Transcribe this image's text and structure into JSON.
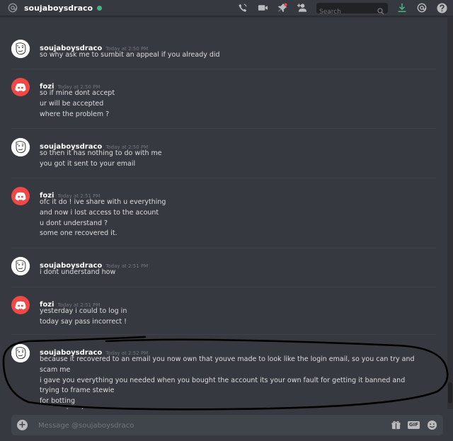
{
  "header": {
    "channel_name": "soujaboysdraco",
    "search_placeholder": "Search"
  },
  "icons": {
    "header": [
      "at-icon",
      "call-icon",
      "video-icon",
      "pin-icon",
      "add-friend-icon",
      "search-icon",
      "download-icon",
      "mention-icon",
      "help-icon"
    ],
    "composer": [
      "add-attachment-icon",
      "gift-icon",
      "gif-icon",
      "emoji-icon"
    ]
  },
  "colors": {
    "background": "#36393f",
    "online_status": "#43b581",
    "fozi_avatar": "#f04747",
    "download_icon": "#43b581"
  },
  "messages": [
    {
      "author": "soujaboysdraco",
      "timestamp": "Today at 2:50 PM",
      "avatar": "draco",
      "lines": [
        "so why ask me to sumbit an appeal if you already did"
      ]
    },
    {
      "author": "fozi",
      "timestamp": "Today at 2:50 PM",
      "avatar": "fozi",
      "lines": [
        "so if mine dont accept",
        "ur will be accepted",
        "where the problem ?"
      ]
    },
    {
      "author": "soujaboysdraco",
      "timestamp": "Today at 2:50 PM",
      "avatar": "draco",
      "lines": [
        "so then it has nothing to do with me",
        "you got it sent to your email"
      ]
    },
    {
      "author": "fozi",
      "timestamp": "Today at 2:51 PM",
      "avatar": "fozi",
      "lines": [
        "ofc it do ! ive share with u everything",
        "and now i lost access to the acount",
        "u dont understand ?",
        "some one recovered it."
      ]
    },
    {
      "author": "soujaboysdraco",
      "timestamp": "Today at 2:51 PM",
      "avatar": "draco",
      "lines": [
        "i dont understand how"
      ]
    },
    {
      "author": "fozi",
      "timestamp": "Today at 2:51 PM",
      "avatar": "fozi",
      "lines": [
        "yesterday i could to log in",
        "today say pass incorrect !"
      ]
    },
    {
      "author": "soujaboysdraco",
      "timestamp": "Today at 2:52 PM",
      "avatar": "draco",
      "lines": [
        "because it recovered to an email you now own that youve made to look like the login email, so you can try and scam me",
        "i gave you everything you needed when you bought the account its your own fault for getting it banned and trying to frame stewie",
        "for botting",
        "youve already proved your a liar"
      ]
    }
  ],
  "composer": {
    "placeholder": "Message @soujaboysdraco",
    "gif_label": "GIF"
  }
}
